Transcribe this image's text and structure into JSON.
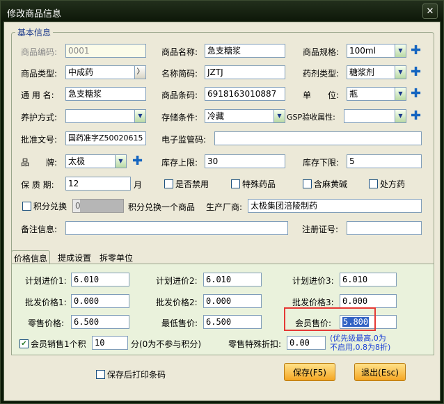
{
  "window": {
    "title": "修改商品信息",
    "close_glyph": "✕"
  },
  "basic": {
    "legend": "基本信息",
    "code": {
      "label": "商品编码:",
      "value": "0001"
    },
    "name": {
      "label": "商品名称:",
      "value": "急支糖浆"
    },
    "spec": {
      "label": "商品规格:",
      "value": "100ml"
    },
    "type": {
      "label": "商品类型:",
      "value": "中成药",
      "button": "〉"
    },
    "abbr": {
      "label": "名称简码:",
      "value": "JZTJ"
    },
    "dosage": {
      "label": "药剂类型:",
      "value": "糖浆剂"
    },
    "generic": {
      "label": "通 用 名:",
      "value": "急支糖浆"
    },
    "barcode": {
      "label": "商品条码:",
      "value": "6918163010887"
    },
    "unit": {
      "label": "单　　位:",
      "value": "瓶"
    },
    "care": {
      "label": "养护方式:",
      "value": ""
    },
    "storage": {
      "label": "存储条件:",
      "value": "冷藏"
    },
    "gsp": {
      "label": "GSP验收属性:",
      "value": ""
    },
    "approval": {
      "label": "批准文号:",
      "value": "国药准字Z50020615"
    },
    "eregcode": {
      "label": "电子监管码:",
      "value": ""
    },
    "brand": {
      "label": "品　　牌:",
      "value": "太极"
    },
    "stock_max": {
      "label": "库存上限:",
      "value": "30"
    },
    "stock_min": {
      "label": "库存下限:",
      "value": "5"
    },
    "shelf": {
      "label": "保 质 期:",
      "value": "12",
      "unit": "月"
    },
    "disabled_cb": "是否禁用",
    "special_cb": "特殊药品",
    "ephedrine_cb": "含麻黄碱",
    "rx_cb": "处方药",
    "points_cb": "积分兑换",
    "points_value": "0",
    "points_text": "积分兑换一个商品",
    "maker": {
      "label": "生产厂商:",
      "value": "太极集团涪陵制药"
    },
    "remark": {
      "label": "备注信息:",
      "value": ""
    },
    "regno": {
      "label": "注册证号:",
      "value": ""
    }
  },
  "tabs": [
    {
      "label": "价格信息"
    },
    {
      "label": "提成设置"
    },
    {
      "label": "拆零单位"
    }
  ],
  "price": {
    "plan1": {
      "label": "计划进价1:",
      "value": "6.010"
    },
    "plan2": {
      "label": "计划进价2:",
      "value": "6.010"
    },
    "plan3": {
      "label": "计划进价3:",
      "value": "6.010"
    },
    "whole1": {
      "label": "批发价格1:",
      "value": "0.000"
    },
    "whole2": {
      "label": "批发价格2:",
      "value": "0.000"
    },
    "whole3": {
      "label": "批发价格3:",
      "value": "0.000"
    },
    "retail": {
      "label": "零售价格:",
      "value": "6.500"
    },
    "lowest": {
      "label": "最低售价:",
      "value": "6.500"
    },
    "member": {
      "label": "会员售价:",
      "value": "5.800"
    },
    "member_points_cb": "会员销售1个积",
    "member_points_value": "10",
    "member_points_unit": "分(0为不参与积分)",
    "discount": {
      "label": "零售特殊折扣:",
      "value": "0.00"
    },
    "discount_note_1": "(优先级最高,0为",
    "discount_note_2": "不启用,0.8为8折)"
  },
  "footer": {
    "print_cb": "保存后打印条码",
    "save": "保存(F5)",
    "exit": "退出(Esc)"
  },
  "icons": {
    "dropdown": "▼",
    "plus": "✚",
    "check": "✔"
  }
}
